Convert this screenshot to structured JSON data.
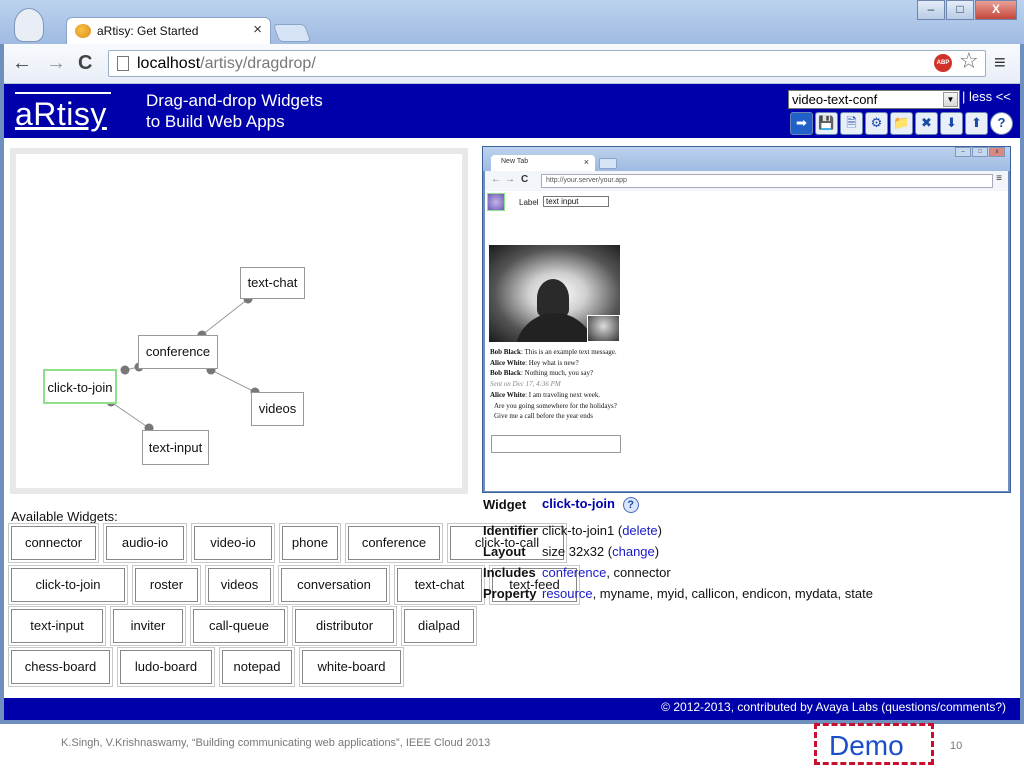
{
  "browser": {
    "tab_title": "aRtisy: Get Started",
    "tab_close": "×",
    "url_host": "localhost",
    "url_path": "/artisy/dragdrop/",
    "controls": {
      "min": "–",
      "max": "□",
      "close": "X"
    },
    "nav": {
      "back": "←",
      "forward": "→",
      "reload": "C"
    },
    "abp_label": "ABP",
    "star": "☆",
    "menu": "≡"
  },
  "app": {
    "logo": "aRtisy",
    "tagline_1": "Drag-and-drop Widgets",
    "tagline_2": "to Build Web Apps",
    "select_value": "video-text-conf",
    "less_link": "| less <<",
    "tool_icons": [
      "go-icon",
      "save-icon",
      "document-icon",
      "settings-icon",
      "add-folder-icon",
      "delete-icon",
      "move-down-icon",
      "move-up-icon",
      "help-icon"
    ],
    "tool_glyphs": [
      "➡",
      "💾",
      "🗎",
      "⚙",
      "📁",
      "✖",
      "⬇",
      "⬆",
      "?"
    ]
  },
  "graph": {
    "nodes": [
      {
        "id": "text-chat",
        "label": "text-chat"
      },
      {
        "id": "conference",
        "label": "conference"
      },
      {
        "id": "click-to-join",
        "label": "click-to-join",
        "selected": true
      },
      {
        "id": "videos",
        "label": "videos"
      },
      {
        "id": "text-input",
        "label": "text-input"
      }
    ],
    "edges": [
      [
        "conference",
        "text-chat"
      ],
      [
        "conference",
        "videos"
      ],
      [
        "click-to-join",
        "conference"
      ],
      [
        "click-to-join",
        "text-input"
      ]
    ]
  },
  "preview": {
    "tab_title": "New Tab",
    "tab_close": "×",
    "url": "http://your.server/your.app",
    "label_text": "Label",
    "input_value": "text input",
    "chat": [
      {
        "who": "Bob Black",
        "text": "This is an example text message."
      },
      {
        "who": "Alice White",
        "text": "Hey what is new?"
      },
      {
        "who": "Bob Black",
        "text": "Nothing much, you say?"
      },
      {
        "meta": "Sent on Dec 17, 4:36 PM"
      },
      {
        "who": "Alice White",
        "text": "I am traveling next week."
      },
      {
        "indent": "Are you going somewhere for the holidays?"
      },
      {
        "indent": "Give me a call before the year ends"
      }
    ]
  },
  "widgets": {
    "label": "Available Widgets:",
    "rows": [
      [
        "connector",
        "audio-io",
        "video-io",
        "phone",
        "conference",
        "click-to-call"
      ],
      [
        "click-to-join",
        "roster",
        "videos",
        "conversation",
        "text-chat",
        "text-feed"
      ],
      [
        "text-input",
        "inviter",
        "call-queue",
        "distributor",
        "dialpad"
      ],
      [
        "chess-board",
        "ludo-board",
        "notepad",
        "white-board"
      ]
    ]
  },
  "info": {
    "widget_key": "Widget",
    "widget_value": "click-to-join",
    "help": "?",
    "identifier_key": "Identifier",
    "identifier_value": "click-to-join1",
    "delete_link": "delete",
    "layout_key": "Layout",
    "layout_value": "size 32x32",
    "change_link": "change",
    "includes_key": "Includes",
    "includes_link": "conference",
    "includes_rest": ", connector",
    "property_key": "Property",
    "property_link": "resource",
    "property_rest": ", myname, myid, callicon, endicon, mydata, state"
  },
  "footer": {
    "text": "© 2012-2013, contributed by Avaya Labs (questions/comments?)"
  },
  "slide": {
    "citation": "K.Singh, V.Krishnaswamy, “Building communicating web applications”, IEEE Cloud 2013",
    "demo": "Demo",
    "page": "10"
  },
  "colors": {
    "header_blue": "#0000aa",
    "selected_node": "#8fe08a",
    "demo_border": "#c8102e",
    "demo_text": "#1a4fc9"
  }
}
